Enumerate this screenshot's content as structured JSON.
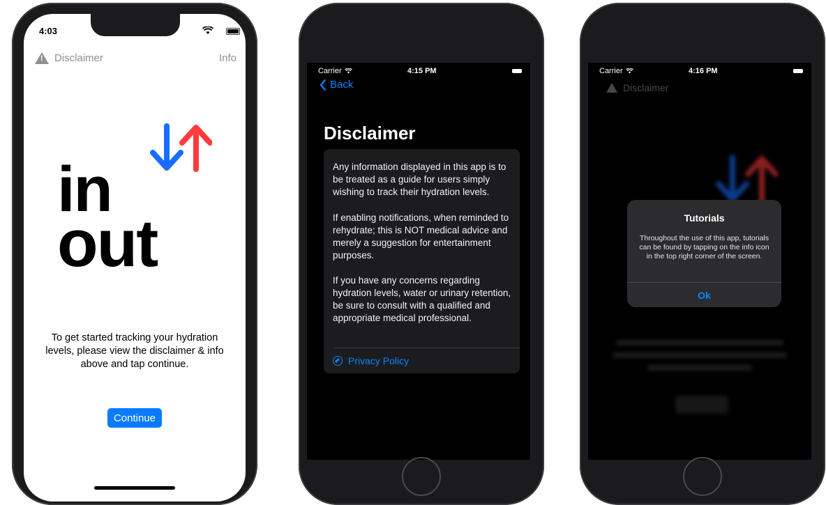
{
  "phone1": {
    "status_time": "4:03",
    "nav_left_label": "Disclaimer",
    "nav_right_label": "Info",
    "logo_word_top": "in",
    "logo_word_bottom": "out",
    "description": "To get started tracking your hydration levels, please view the disclaimer & info above and tap continue.",
    "continue_label": "Continue",
    "icons": [
      "warning-icon",
      "down-arrow-icon",
      "up-arrow-icon",
      "wifi-icon",
      "battery-icon"
    ],
    "colors": {
      "arrow_down": "#1a6cff",
      "arrow_up": "#ff3b3b",
      "accent": "#0a7aff"
    }
  },
  "phone2": {
    "carrier": "Carrier",
    "status_time": "4:15 PM",
    "back_label": "Back",
    "title": "Disclaimer",
    "paragraphs": [
      "Any information displayed in this app is to be treated as a guide for users simply wishing to track their hydration levels.",
      "If enabling notifications, when reminded to rehydrate; this is NOT medical advice and merely a suggestion for entertainment purposes.",
      "If you have any concerns regarding hydration levels, water or urinary retention, be sure to consult with a qualified and appropriate medical professional."
    ],
    "privacy_label": "Privacy Policy",
    "icons": [
      "chevron-left-icon",
      "compass-icon"
    ]
  },
  "phone3": {
    "carrier": "Carrier",
    "status_time": "4:16 PM",
    "background_nav_label": "Disclaimer",
    "alert": {
      "title": "Tutorials",
      "message": "Throughout the use of this app, tutorials can be found by tapping on the info icon in the top right corner of the screen.",
      "ok_label": "Ok"
    }
  }
}
